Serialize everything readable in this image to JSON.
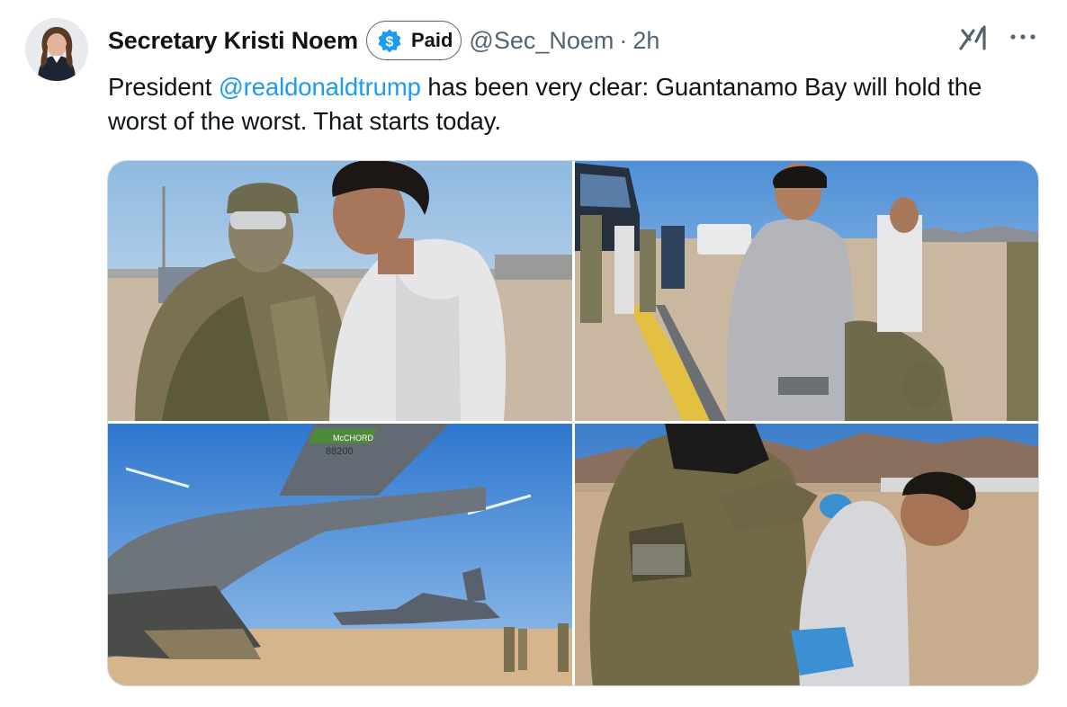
{
  "tweet": {
    "author_name": "Secretary Kristi Noem",
    "badge_label": "Paid",
    "handle": "@Sec_Noem",
    "separator": "·",
    "time": "2h",
    "text_before_mention": "President ",
    "mention": "@realdonaldtrump",
    "text_after_mention": " has been very clear: Guantanamo Bay will hold the worst of the worst. That starts today."
  },
  "media": {
    "photo_3_tail_marking": "McCHORD",
    "photo_3_tail_number": "88200"
  },
  "icons": {
    "avatar": "profile-photo",
    "badge": "dollar-sign-icon",
    "grok": "grok-icon",
    "more": "more-horizontal-icon"
  },
  "colors": {
    "text": "#0f1419",
    "secondary": "#536471",
    "link": "#1d9bf0",
    "badge_fill": "#1d9bf0",
    "border": "#cfd9de"
  }
}
